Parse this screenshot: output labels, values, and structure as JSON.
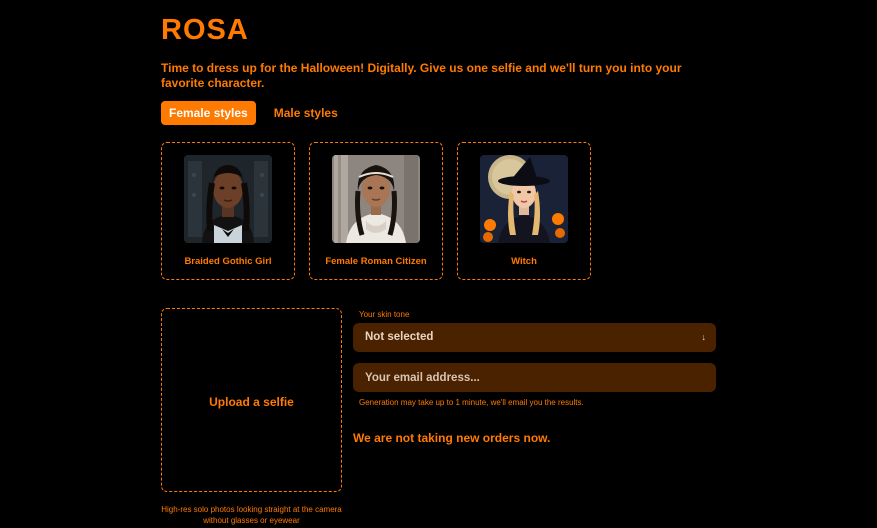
{
  "brand": "ROSA",
  "tagline": "Time to dress up for the Halloween! Digitally. Give us one selfie and we'll turn you into your favorite character.",
  "tabs": [
    {
      "label": "Female styles",
      "active": true
    },
    {
      "label": "Male styles",
      "active": false
    }
  ],
  "styles": [
    {
      "label": "Braided Gothic Girl"
    },
    {
      "label": "Female Roman Citizen"
    },
    {
      "label": "Witch"
    }
  ],
  "upload": {
    "label": "Upload a selfie",
    "hint": "High-res solo photos looking straight at the camera without glasses or eyewear"
  },
  "form": {
    "skin_label": "Your skin tone",
    "skin_value": "Not selected",
    "email_placeholder": "Your email address...",
    "generation_note": "Generation may take up to 1 minute, we'll email you the results."
  },
  "status": "We are not taking new orders now.",
  "colors": {
    "accent": "#ff7a00",
    "field_bg": "#4a2200",
    "background": "#000000"
  }
}
